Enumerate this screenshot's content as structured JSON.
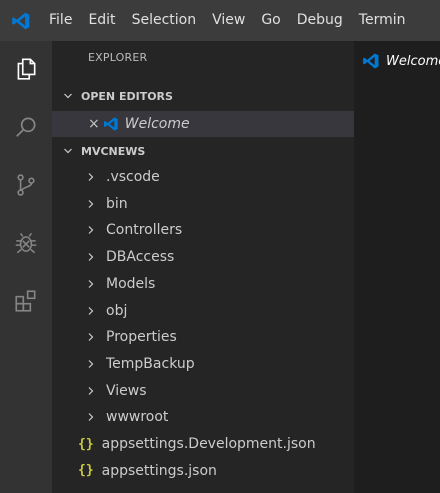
{
  "menu": [
    "File",
    "Edit",
    "Selection",
    "View",
    "Go",
    "Debug",
    "Termin"
  ],
  "icons": {
    "app": "vscode-logo-icon",
    "activity": [
      "files-icon",
      "search-icon",
      "source-control-icon",
      "debug-icon",
      "extensions-icon"
    ],
    "json": "{}"
  },
  "sidebar": {
    "title": "EXPLORER",
    "open_editors": {
      "header": "OPEN EDITORS",
      "items": [
        {
          "label": "Welcome"
        }
      ]
    },
    "project": {
      "header": "MVCNEWS",
      "folders": [
        ".vscode",
        "bin",
        "Controllers",
        "DBAccess",
        "Models",
        "obj",
        "Properties",
        "TempBackup",
        "Views",
        "wwwroot"
      ],
      "files": [
        "appsettings.Development.json",
        "appsettings.json"
      ]
    }
  },
  "editor": {
    "tab_label": "Welcome"
  },
  "colors": {
    "accent": "#0078d4",
    "json_icon": "#cbcb41"
  }
}
